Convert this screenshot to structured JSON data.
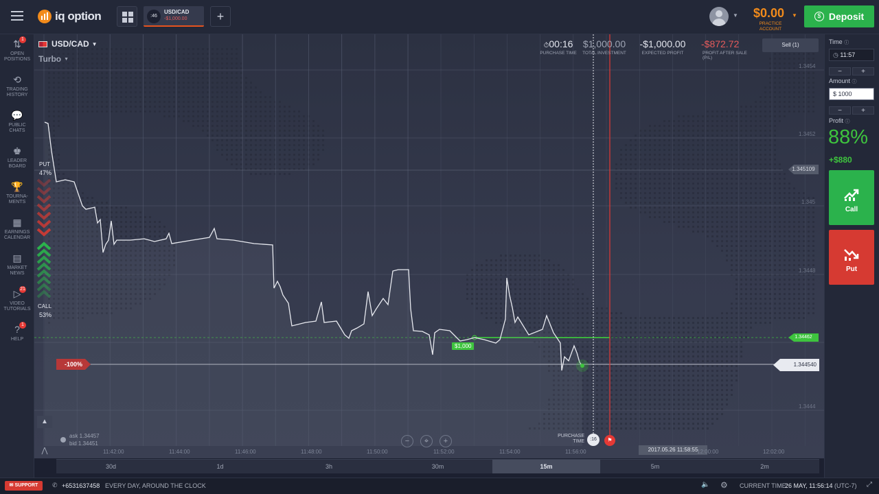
{
  "header": {
    "brand": "iq option",
    "asset_tab": {
      "name": "USD/CAD",
      "timer": ":46",
      "pnl": "-$1,000.00"
    },
    "balance": "$0.00",
    "account_type_line1": "PRACTICE",
    "account_type_line2": "ACCOUNT",
    "deposit_label": "Deposit"
  },
  "sidebar": {
    "items": [
      {
        "line1": "OPEN",
        "line2": "POSITIONS",
        "badge": "1"
      },
      {
        "line1": "TRADING",
        "line2": "HISTORY"
      },
      {
        "line1": "PUBLIC",
        "line2": "CHATS"
      },
      {
        "line1": "LEADER",
        "line2": "BOARD"
      },
      {
        "line1": "TOURNA-",
        "line2": "MENTS"
      },
      {
        "line1": "EARNINGS",
        "line2": "CALENDAR"
      },
      {
        "line1": "MARKET",
        "line2": "NEWS"
      },
      {
        "line1": "VIDEO",
        "line2": "TUTORIALS",
        "badge": "21"
      },
      {
        "line1": "HELP",
        "line2": "",
        "badge": "1"
      }
    ]
  },
  "chart_header": {
    "asset": "USD/CAD",
    "mode": "Turbo",
    "purchase_time_value": "00:16",
    "purchase_time_label": "PURCHASE TIME",
    "total_investment_value": "$1,000.00",
    "total_investment_label": "TOTAL INVESTMENT",
    "expected_profit_value": "-$1,000.00",
    "expected_profit_label": "EXPECTED PROFIT",
    "profit_after_sale_value": "-$872.72",
    "profit_after_sale_label1": "PROFIT AFTER SALE",
    "profit_after_sale_label2": "(P/L)",
    "sell_button": "Sell (1)"
  },
  "sentiment": {
    "put_label": "PUT",
    "put_pct": "47%",
    "call_label": "CALL",
    "call_pct": "53%"
  },
  "chart": {
    "price_labels": [
      "1.3454",
      "1.3452",
      "1.345",
      "1.3448",
      "1.3446",
      "1.3444"
    ],
    "current_price": "1.344540",
    "high_marker": "1.345109",
    "strike_marker": "1.34462",
    "investment_tag": "$1,000",
    "loss_tag": "-100%",
    "ask": "ask 1.34457",
    "bid": "bid 1.34451",
    "purchase_time_label1": "PURCHASE",
    "purchase_time_label2": "TIME",
    "timer": ":16",
    "expiry_datetime": "2017.05.26 11:58:55",
    "time_ticks": [
      "11:42:00",
      "11:44:00",
      "11:46:00",
      "11:48:00",
      "11:50:00",
      "11:52:00",
      "11:54:00",
      "11:56:00",
      "12:00:00",
      "12:02:00"
    ],
    "timeframes": [
      "30d",
      "1d",
      "3h",
      "30m",
      "15m",
      "5m",
      "2m"
    ],
    "active_timeframe": "15m",
    "line_color": "#e8eaf0",
    "strike_color": "#3ec43e",
    "expiry_color": "#e53935"
  },
  "right_panel": {
    "time_label": "Time",
    "time_value": "11:57",
    "amount_label": "Amount",
    "amount_value": "$ 1000",
    "profit_label": "Profit",
    "profit_pct": "88%",
    "profit_value": "+$880",
    "call_label": "Call",
    "put_label": "Put",
    "minus": "−",
    "plus": "+"
  },
  "footer": {
    "support": "SUPPORT",
    "phone": "+6531637458",
    "hours": "EVERY DAY, AROUND THE CLOCK",
    "current_time_label": "CURRENT TIME:",
    "current_time": "26 MAY, 11:56:14",
    "timezone": "(UTC-7)"
  }
}
